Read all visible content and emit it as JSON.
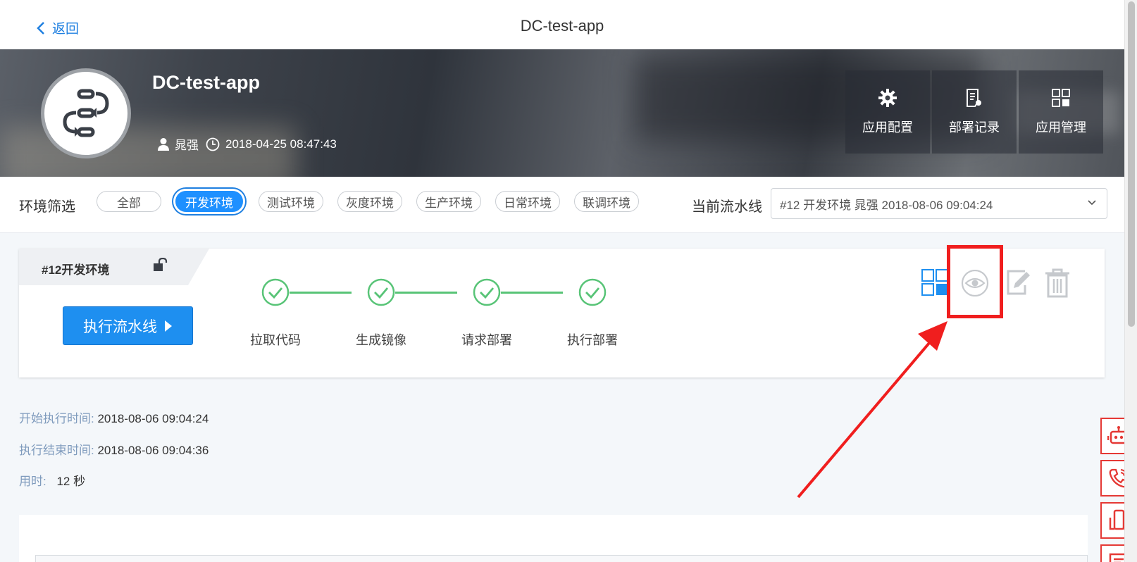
{
  "header": {
    "back_label": "返回",
    "title": "DC-test-app"
  },
  "app": {
    "name": "DC-test-app",
    "owner": "晁强",
    "created_at": "2018-04-25 08:47:43",
    "actions": [
      {
        "label": "应用配置",
        "icon": "gear-icon"
      },
      {
        "label": "部署记录",
        "icon": "document-icon"
      },
      {
        "label": "应用管理",
        "icon": "grid-icon"
      }
    ]
  },
  "filter": {
    "label": "环境筛选",
    "chips": [
      "全部",
      "开发环境",
      "测试环境",
      "灰度环境",
      "生产环境",
      "日常环境",
      "联调环境"
    ],
    "active": "开发环境",
    "pipeline_label": "当前流水线",
    "pipeline_value": "#12 开发环境 晁强 2018-08-06 09:04:24"
  },
  "pipeline": {
    "tab_title": "#12开发环境",
    "run_button": "执行流水线",
    "steps": [
      "拉取代码",
      "生成镜像",
      "请求部署",
      "执行部署"
    ],
    "step_status": "success",
    "tools": [
      "grid-view-icon",
      "eye-icon",
      "edit-icon",
      "trash-icon"
    ]
  },
  "run_info": {
    "start_label": "开始执行时间:",
    "start_value": "2018-08-06 09:04:24",
    "end_label": "执行结束时间:",
    "end_value": "2018-08-06 09:04:36",
    "duration_label": "用时:",
    "duration_value": "12 秒"
  },
  "colors": {
    "primary": "#1e8ff0",
    "success": "#58c477",
    "highlight": "#f01e1e"
  }
}
